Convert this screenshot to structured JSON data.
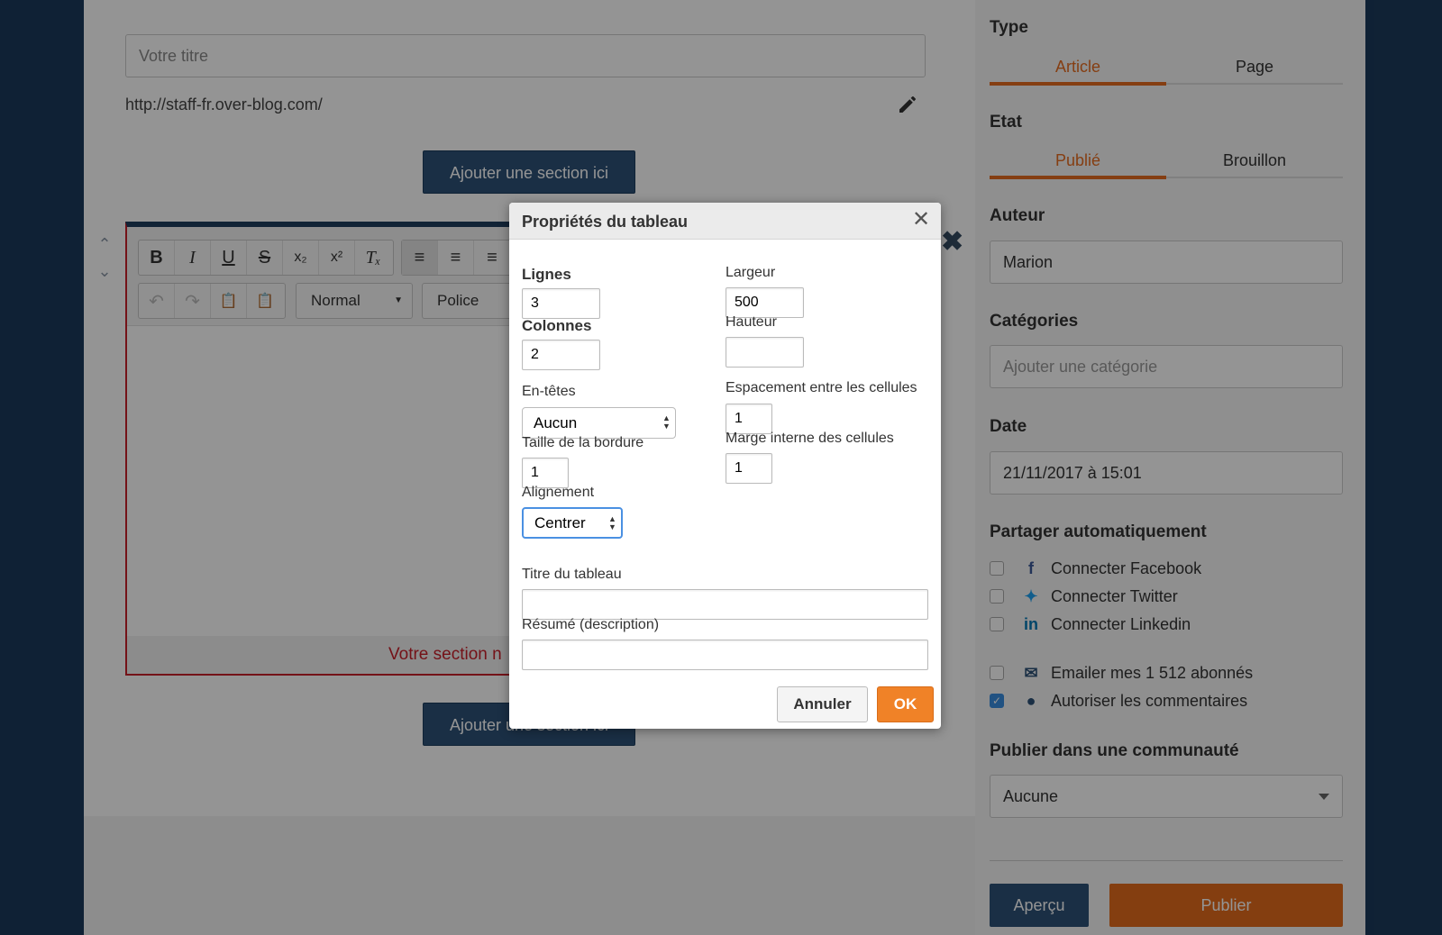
{
  "editor": {
    "title_placeholder": "Votre titre",
    "url": "http://staff-fr.over-blog.com/",
    "add_section_label": "Ajouter une section ici",
    "add_section_bottom_label": "Ajouter une section ici",
    "empty_section_text": "Votre section n",
    "toolbar": {
      "format_value": "Normal",
      "font_value": "Police"
    }
  },
  "sidebar": {
    "type_heading": "Type",
    "type_tabs": [
      "Article",
      "Page"
    ],
    "etat_heading": "Etat",
    "etat_tabs": [
      "Publié",
      "Brouillon"
    ],
    "author_heading": "Auteur",
    "author_value": "Marion",
    "categories_heading": "Catégories",
    "categories_placeholder": "Ajouter une catégorie",
    "date_heading": "Date",
    "date_value": "21/11/2017 à 15:01",
    "share_heading": "Partager automatiquement",
    "share_items": [
      {
        "label": "Connecter Facebook",
        "icon": "facebook-icon",
        "checked": false
      },
      {
        "label": "Connecter Twitter",
        "icon": "twitter-icon",
        "checked": false
      },
      {
        "label": "Connecter Linkedin",
        "icon": "linkedin-icon",
        "checked": false
      }
    ],
    "email_label": "Emailer mes 1 512 abonnés",
    "comments_label": "Autoriser les commentaires",
    "community_heading": "Publier dans une communauté",
    "community_value": "Aucune",
    "preview_label": "Aperçu",
    "publish_label": "Publier"
  },
  "dialog": {
    "title": "Propriétés du tableau",
    "rows_label": "Lignes",
    "rows_value": "3",
    "cols_label": "Colonnes",
    "cols_value": "2",
    "width_label": "Largeur",
    "width_value": "500",
    "height_label": "Hauteur",
    "height_value": "",
    "headers_label": "En-têtes",
    "headers_value": "Aucun",
    "spacing_label": "Espacement entre les cellules",
    "spacing_value": "1",
    "border_label": "Taille de la bordure",
    "border_value": "1",
    "padding_label": "Marge interne des cellules",
    "padding_value": "1",
    "align_label": "Alignement",
    "align_value": "Centrer",
    "caption_label": "Titre du tableau",
    "caption_value": "",
    "summary_label": "Résumé (description)",
    "summary_value": "",
    "cancel_label": "Annuler",
    "ok_label": "OK"
  },
  "colors": {
    "accent": "#e56b1f",
    "primary": "#2d5277",
    "error": "#c9202a",
    "background": "#1b3a5c"
  }
}
